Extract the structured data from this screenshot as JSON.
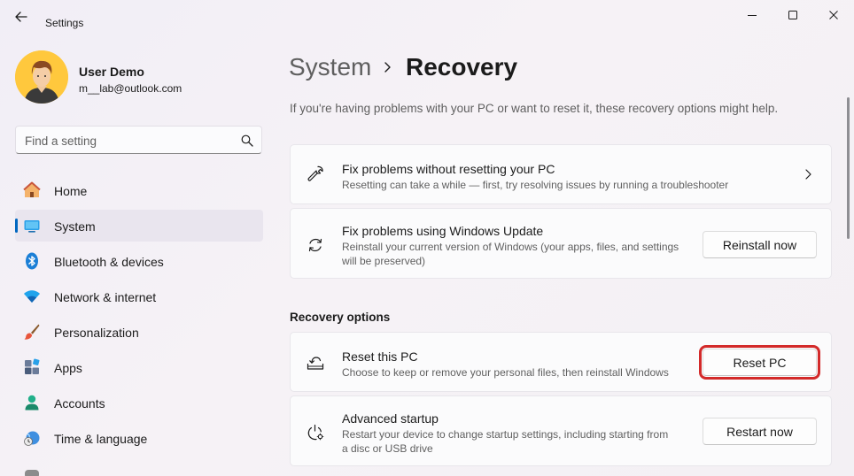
{
  "window": {
    "app_title": "Settings"
  },
  "user": {
    "name": "User Demo",
    "email": "m__lab@outlook.com"
  },
  "search": {
    "placeholder": "Find a setting",
    "value": ""
  },
  "sidebar": {
    "items": [
      {
        "label": "Home",
        "icon": "home-icon",
        "active": false
      },
      {
        "label": "System",
        "icon": "system-icon",
        "active": true
      },
      {
        "label": "Bluetooth & devices",
        "icon": "bluetooth-icon",
        "active": false
      },
      {
        "label": "Network & internet",
        "icon": "network-icon",
        "active": false
      },
      {
        "label": "Personalization",
        "icon": "personalization-icon",
        "active": false
      },
      {
        "label": "Apps",
        "icon": "apps-icon",
        "active": false
      },
      {
        "label": "Accounts",
        "icon": "accounts-icon",
        "active": false
      },
      {
        "label": "Time & language",
        "icon": "time-language-icon",
        "active": false
      }
    ]
  },
  "header": {
    "breadcrumb_parent": "System",
    "breadcrumb_current": "Recovery",
    "intro": "If you're having problems with your PC or want to reset it, these recovery options might help."
  },
  "cards": {
    "fix_no_reset": {
      "title": "Fix problems without resetting your PC",
      "description": "Resetting can take a while — first, try resolving issues by running a troubleshooter",
      "icon": "wrench-icon"
    },
    "fix_update": {
      "title": "Fix problems using Windows Update",
      "description_line1": "Reinstall your current version of Windows (your apps, files, and settings",
      "description_line2": "will be preserved)",
      "button": "Reinstall now",
      "icon": "refresh-icon"
    }
  },
  "recovery_options": {
    "heading": "Recovery options",
    "reset": {
      "title": "Reset this PC",
      "description": "Choose to keep or remove your personal files, then reinstall Windows",
      "button": "Reset PC",
      "icon": "reset-pc-icon"
    },
    "advanced": {
      "title": "Advanced startup",
      "description_line1": "Restart your device to change startup settings, including starting from",
      "description_line2": "a disc or USB drive",
      "button": "Restart now",
      "icon": "advanced-startup-icon"
    }
  },
  "colors": {
    "accent": "#0067c0",
    "highlight_border": "#d32a2a",
    "background": "#f3f0f5"
  }
}
